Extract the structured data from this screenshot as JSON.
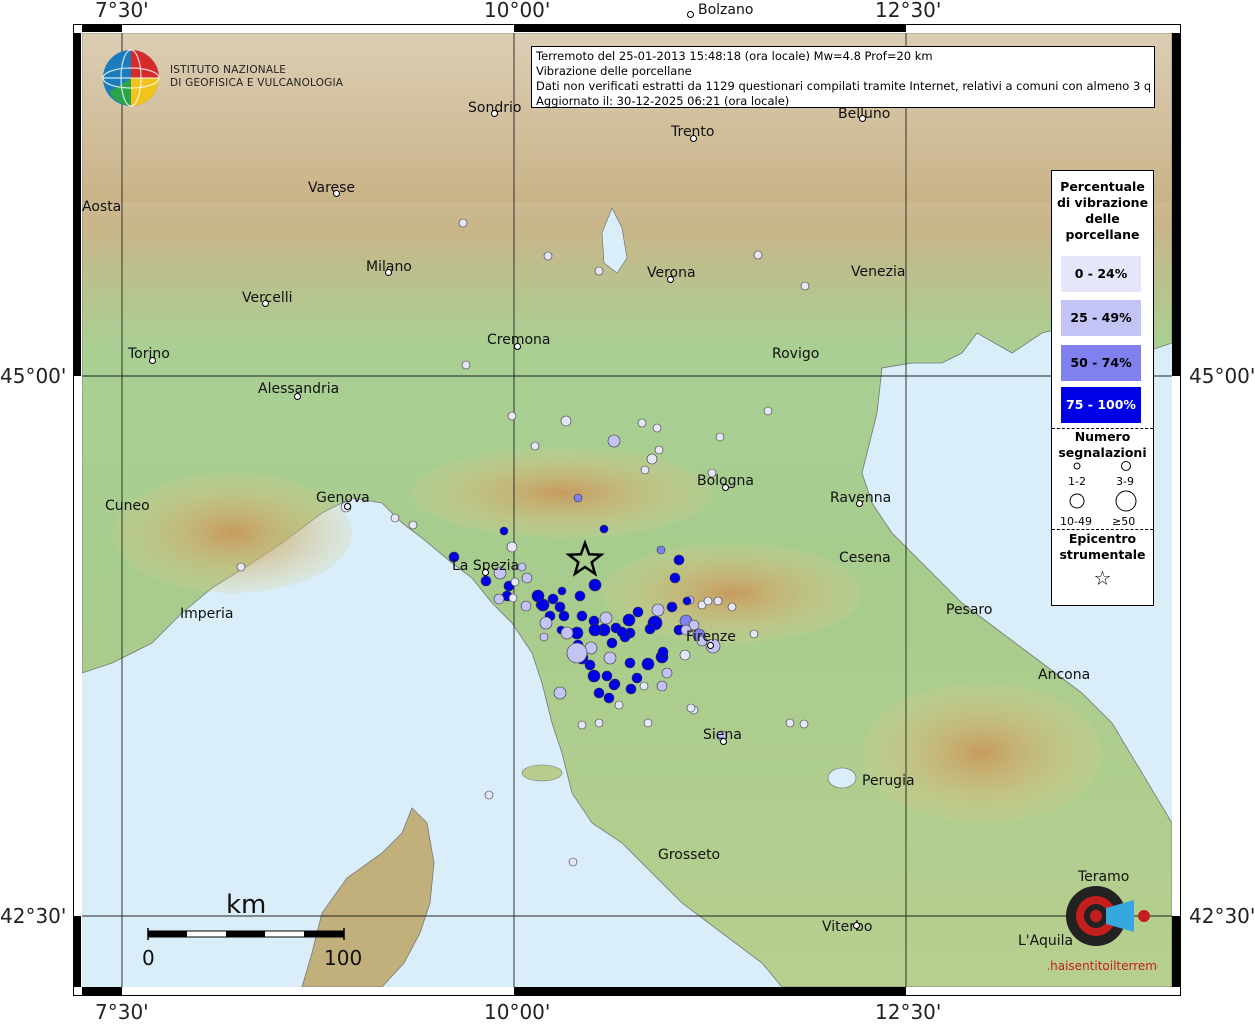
{
  "map": {
    "info": {
      "line1": "Terremoto del 25-01-2013 15:48:18 (ora locale) Mw=4.8 Prof=20 km",
      "line2": "Vibrazione delle porcellane",
      "line3": "Dati non verificati estratti da 1129 questionari compilati tramite Internet, relativi a comuni con almeno 3 questionari.",
      "line4": "Aggiornato il: 30-12-2025 06:21 (ora locale)"
    },
    "logo": {
      "line1": "ISTITUTO NAZIONALE",
      "line2": "DI GEOFISICA E VULCANOLOGIA"
    },
    "coords": {
      "lon_left": "7°30'",
      "lon_mid": "10°00'",
      "lon_right": "12°30'",
      "lat_top": "45°00'",
      "lat_bottom": "42°30'"
    },
    "legend": {
      "title": "Percentuale di vibrazione delle porcellane",
      "classes": [
        {
          "label": "0 - 24%",
          "color": "#e6e6fa"
        },
        {
          "label": "25 - 49%",
          "color": "#c3c3f5"
        },
        {
          "label": "50 - 74%",
          "color": "#8080ee"
        },
        {
          "label": "75 - 100%",
          "color": "#0000e6"
        }
      ],
      "count_title": "Numero segnalazioni",
      "count_classes": [
        "1-2",
        "3-9",
        "10-49",
        "≥50"
      ],
      "epicenter_title": "Epicentro strumentale",
      "epicenter_symbol": "☆"
    },
    "scale": {
      "unit": "km",
      "min": "0",
      "max": "100"
    },
    "cities": [
      "Bolzano",
      "Sondrio",
      "Trento",
      "Belluno",
      "Varese",
      "Aosta",
      "Milano",
      "Verona",
      "Venezia",
      "Vercelli",
      "Cremona",
      "Torino",
      "Rovigo",
      "Alessandria",
      "Bologna",
      "Cuneo",
      "Genova",
      "Ravenna",
      "La Spezia",
      "Cesena",
      "Imperia",
      "Pesaro",
      "Firenze",
      "Ancona",
      "Siena",
      "Perugia",
      "Grosseto",
      "Teramo",
      "Viterbo",
      "L'Aquila"
    ],
    "watermark": "www.haisentitoilterremoto.it",
    "colors": {
      "sea": "#d9eef8",
      "lowland": "#a8cf92",
      "hill": "#d8c98a",
      "mountain": "#c09a6a",
      "snow": "#f4f4f4"
    }
  }
}
